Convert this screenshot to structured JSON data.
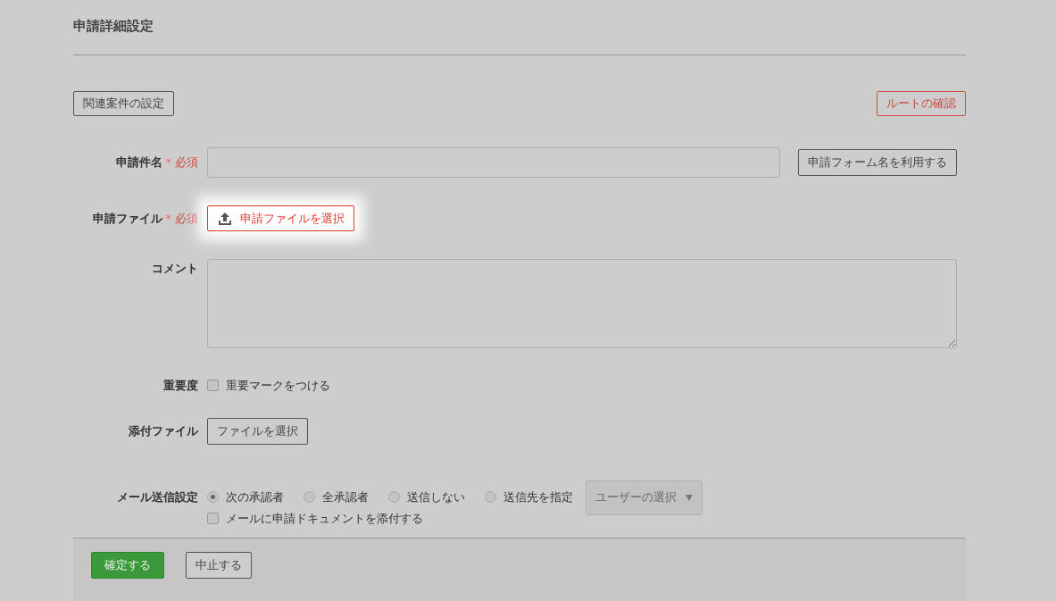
{
  "title": "申請詳細設定",
  "top_buttons": [
    {
      "label": "関連案件の設定",
      "kind": "plain"
    },
    {
      "label": "ルートの確認",
      "kind": "danger"
    }
  ],
  "subject": {
    "label": "申請件名",
    "asterisk": "*",
    "required": "必須",
    "button": "申請フォーム名を利用する"
  },
  "application_file": {
    "label": "申請ファイル",
    "asterisk": "*",
    "required": "必須",
    "button": "申請ファイルを選択"
  },
  "comment": {
    "label": "コメント"
  },
  "importance": {
    "label": "重要度",
    "checkbox": {
      "label": "重要マークをつける",
      "checked": false
    }
  },
  "attachment": {
    "label": "添付ファイル",
    "button": "ファイルを選択"
  },
  "mail": {
    "label": "メール送信設定",
    "options": [
      {
        "label": "次の承認者",
        "selected": true
      },
      {
        "label": "全承認者",
        "selected": false
      },
      {
        "label": "送信しない",
        "selected": false
      },
      {
        "label": "送信先を指定",
        "selected": false
      }
    ],
    "user_select": {
      "label": "ユーザーの選択",
      "disabled": true
    },
    "attach_checkbox": {
      "label": "メールに申請ドキュメントを添付する",
      "checked": false
    }
  },
  "footer_buttons": [
    {
      "label": "確定する",
      "kind": "primary"
    },
    {
      "label": "中止する",
      "kind": "plain"
    }
  ]
}
